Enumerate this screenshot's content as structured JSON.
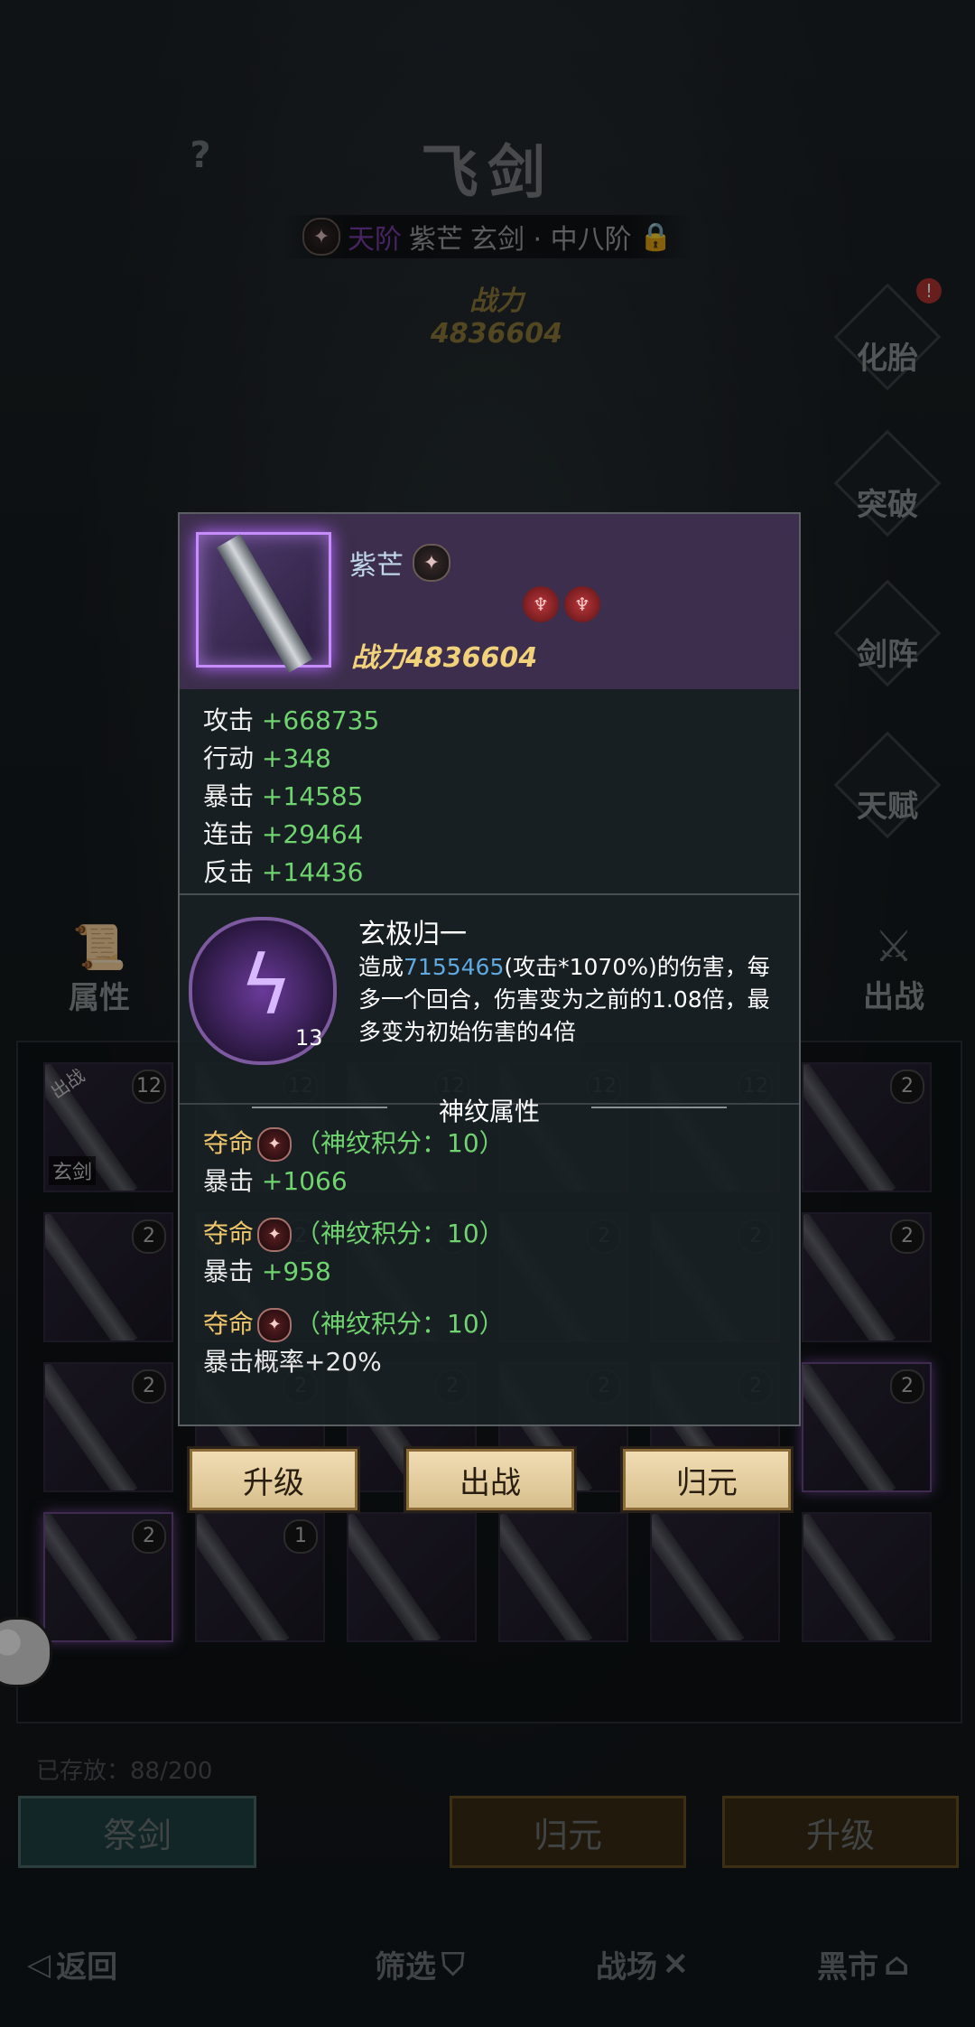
{
  "header": {
    "help": "?",
    "title": "飞剑",
    "rank_prefix": "天阶",
    "rank_name": "紫芒",
    "rank_suffix": "玄剑 · 中八阶",
    "power": "战力4836604"
  },
  "side_menu": {
    "items": [
      "化胎",
      "突破",
      "剑阵",
      "天赋"
    ],
    "notification": "!",
    "attributes": "属性",
    "deploy": "出战"
  },
  "grid": {
    "row1_badges": [
      "12",
      "12",
      "12",
      "12",
      "12",
      "2"
    ],
    "row1_first_label": "玄剑",
    "row1_first_tag": "出战",
    "row2_badges": [
      "2",
      "2",
      "2",
      "2",
      "2",
      "2"
    ],
    "row3_badges": [
      "2",
      "2",
      "2",
      "2",
      "2",
      "2"
    ],
    "row4_badges": [
      "2",
      "1",
      "",
      "",
      "",
      ""
    ]
  },
  "storage": "已存放：88/200",
  "bottom": {
    "sacrifice": "祭剑",
    "return": "归元",
    "upgrade": "升级"
  },
  "footer": {
    "back": "返回",
    "filter": "筛选",
    "battlefield": "战场",
    "black_market": "黑市"
  },
  "popup": {
    "name": "紫芒",
    "power": "战力4836604",
    "stats": [
      {
        "name": "攻击",
        "value": "+668735"
      },
      {
        "name": "行动",
        "value": "+348"
      },
      {
        "name": "暴击",
        "value": "+14585"
      },
      {
        "name": "连击",
        "value": "+29464"
      },
      {
        "name": "反击",
        "value": "+14436"
      }
    ],
    "skill": {
      "title": "玄极归一",
      "level": "13",
      "desc_pre": "造成",
      "desc_value": "7155465",
      "desc_post": "(攻击*1070%)的伤害，每多一个回合，伤害变为之前的1.08倍，最多变为初始伤害的4倍"
    },
    "rune_header": "神纹属性",
    "runes": [
      {
        "name": "夺命",
        "score": "（神纹积分：10）",
        "effect_name": "暴击",
        "effect_value": "+1066"
      },
      {
        "name": "夺命",
        "score": "（神纹积分：10）",
        "effect_name": "暴击",
        "effect_value": "+958"
      },
      {
        "name": "夺命",
        "score": "（神纹积分：10）",
        "effect_name": "暴击概率+20%",
        "effect_value": ""
      }
    ],
    "actions": {
      "upgrade": "升级",
      "deploy": "出战",
      "return": "归元"
    }
  }
}
